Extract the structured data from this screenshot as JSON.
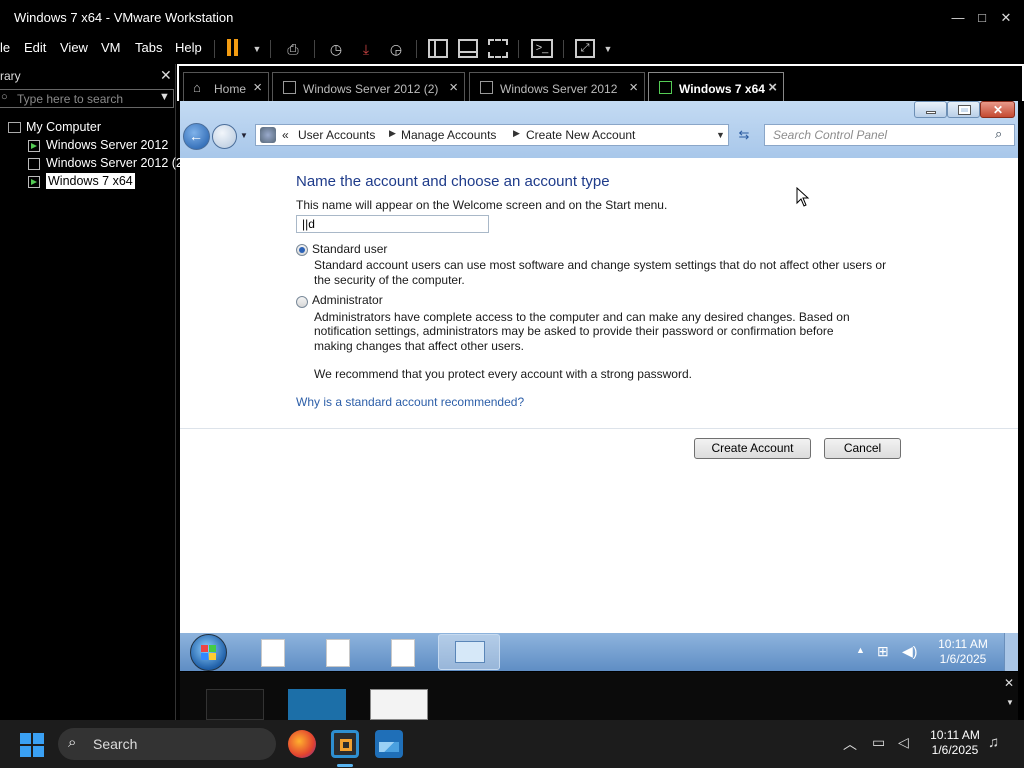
{
  "window": {
    "title": "Windows 7 x64 - VMware Workstation",
    "min": "—",
    "max": "□",
    "close": "✕"
  },
  "menubar": {
    "items": [
      "le",
      "Edit",
      "View",
      "VM",
      "Tabs",
      "Help"
    ]
  },
  "sidebar": {
    "title": "rary",
    "close": "✕",
    "search_placeholder": "Type here to search",
    "tree": {
      "root": "My Computer",
      "vms": [
        "Windows Server 2012",
        "Windows Server 2012 (2",
        "Windows 7 x64"
      ]
    }
  },
  "tabs": [
    {
      "label": "Home"
    },
    {
      "label": "Windows Server 2012 (2)"
    },
    {
      "label": "Windows Server 2012"
    },
    {
      "label": "Windows 7 x64"
    }
  ],
  "guest": {
    "breadcrumb": {
      "prefix": "«",
      "items": [
        "User Accounts",
        "Manage Accounts",
        "Create New Account"
      ]
    },
    "search_placeholder": "Search Control Panel",
    "heading": "Name the account and choose an account type",
    "subtitle": "This name will appear on the Welcome screen and on the Start menu.",
    "name_value": "||d",
    "standard": {
      "label": "Standard user",
      "desc1": "Standard account users can use most software and change system settings that do not affect other users or",
      "desc2": "the security of the computer."
    },
    "admin": {
      "label": "Administrator",
      "desc1": "Administrators have complete access to the computer and can make any desired changes. Based on",
      "desc2": "notification settings, administrators may be asked to provide their password or confirmation before",
      "desc3": "making changes that affect other users."
    },
    "recommend": "We recommend that you protect every account with a strong password.",
    "why_link": "Why is a standard account recommended?",
    "create_button": "Create Account",
    "cancel_button": "Cancel"
  },
  "guest_taskbar": {
    "time": "10:11 AM",
    "date": "1/6/2025"
  },
  "host_taskbar": {
    "search": "Search",
    "time": "10:11 AM",
    "date": "1/6/2025"
  }
}
